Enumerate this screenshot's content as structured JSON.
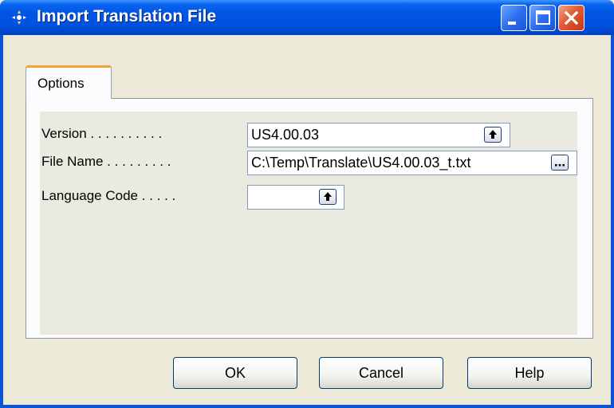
{
  "window": {
    "title": "Import Translation File",
    "icons": [
      "app-icon",
      "minimize-icon",
      "maximize-icon",
      "close-icon"
    ]
  },
  "tabs": [
    {
      "label": "Options"
    }
  ],
  "fields": {
    "version": {
      "label": "Version . . . . . . . . . .",
      "value": "US4.00.03",
      "icon": "lookup-arrow-icon"
    },
    "file_name": {
      "label": "File Name . . . . . . . . .",
      "value": "C:\\Temp\\Translate\\US4.00.03_t.txt",
      "icon": "ellipsis-icon"
    },
    "language_code": {
      "label": "Language Code . . . . .",
      "value": "",
      "icon": "lookup-arrow-icon"
    }
  },
  "buttons": {
    "ok": "OK",
    "cancel": "Cancel",
    "help": "Help"
  },
  "colors": {
    "titlebar": "#0055E5",
    "tab_accent": "#F0A632",
    "dialog_bg": "#ECE9D8",
    "close_button": "#E35A33"
  }
}
